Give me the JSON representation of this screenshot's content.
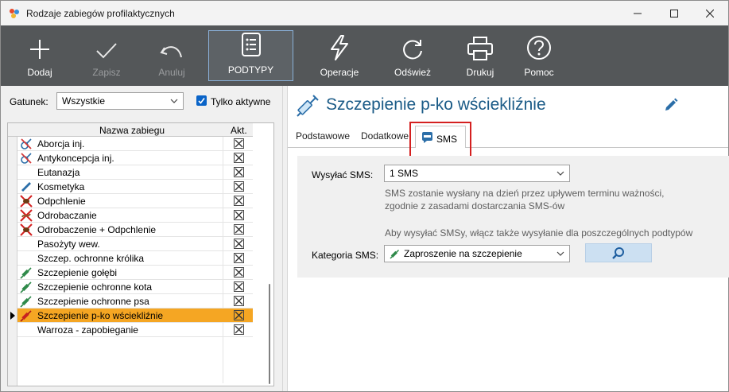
{
  "window": {
    "title": "Rodzaje zabiegów profilaktycznych"
  },
  "toolbar": {
    "add": "Dodaj",
    "save": "Zapisz",
    "cancel": "Anuluj",
    "subtypes": "PODTYPY",
    "operations": "Operacje",
    "refresh": "Odśwież",
    "print": "Drukuj",
    "help": "Pomoc"
  },
  "filter": {
    "gatunek_label": "Gatunek:",
    "gatunek_value": "Wszystkie",
    "active_only_label": "Tylko aktywne",
    "active_only_checked": true
  },
  "grid": {
    "col_name": "Nazwa zabiegu",
    "col_active": "Akt.",
    "rows": [
      {
        "name": "Aborcja inj.",
        "icon": "syringe-gender-icon"
      },
      {
        "name": "Antykoncepcja inj.",
        "icon": "syringe-gender-icon"
      },
      {
        "name": "Eutanazja",
        "icon": ""
      },
      {
        "name": "Kosmetyka",
        "icon": "comb-icon"
      },
      {
        "name": "Odpchlenie",
        "icon": "flea-icon"
      },
      {
        "name": "Odrobaczanie",
        "icon": "worm-icon"
      },
      {
        "name": "Odrobaczenie + Odpchlenie",
        "icon": "flea-icon"
      },
      {
        "name": "Pasożyty wew.",
        "icon": ""
      },
      {
        "name": "Szczep. ochronne królika",
        "icon": ""
      },
      {
        "name": "Szczepienie gołębi",
        "icon": "syringe-icon"
      },
      {
        "name": "Szczepienie ochronne kota",
        "icon": "syringe-icon"
      },
      {
        "name": "Szczepienie ochronne psa",
        "icon": "syringe-icon"
      },
      {
        "name": "Szczepienie p-ko wściekliźnie",
        "icon": "syringe-red-icon",
        "selected": true
      },
      {
        "name": "Warroza - zapobieganie",
        "icon": ""
      }
    ]
  },
  "detail": {
    "title": "Szczepienie p-ko wściekliźnie",
    "tabs": {
      "basic": "Podstawowe",
      "extra": "Dodatkowe",
      "sms": "SMS"
    },
    "send_sms_label": "Wysyłać SMS:",
    "send_sms_value": "1 SMS",
    "note1_line1": "SMS zostanie wysłany na dzień przez upływem terminu ważności,",
    "note1_line2": "zgodnie z zasadami dostarczania SMS-ów",
    "note2": "Aby wysyłać SMSy, włącz także wysyłanie dla poszczególnych podtypów",
    "category_label": "Kategoria SMS:",
    "category_value": "Zaproszenie na szczepienie"
  },
  "colors": {
    "toolbar_bg": "#545759",
    "selected_row": "#f5a623",
    "heading": "#1b5b87",
    "highlight": "#d42020"
  }
}
